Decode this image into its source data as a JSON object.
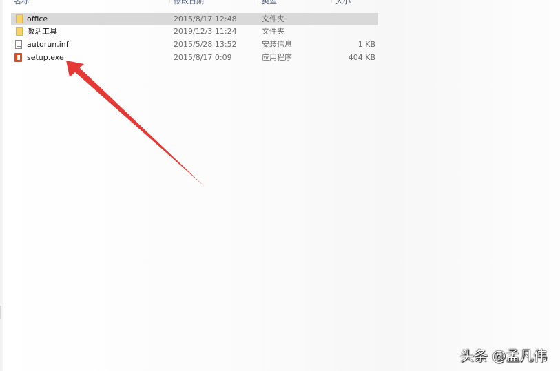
{
  "columns": {
    "name": "名称",
    "date": "修改日期",
    "type": "类型",
    "size": "大小"
  },
  "files": [
    {
      "name": "office",
      "date": "2015/8/17 12:48",
      "type": "文件夹",
      "size": "",
      "icon": "folder-icon",
      "selected": true
    },
    {
      "name": "激活工具",
      "date": "2019/12/3 11:24",
      "type": "文件夹",
      "size": "",
      "icon": "folder-icon",
      "selected": false
    },
    {
      "name": "autorun.inf",
      "date": "2015/5/28 13:52",
      "type": "安装信息",
      "size": "1 KB",
      "icon": "settings-file-icon",
      "selected": false
    },
    {
      "name": "setup.exe",
      "date": "2015/8/17 0:09",
      "type": "应用程序",
      "size": "404 KB",
      "icon": "office-icon",
      "selected": false
    }
  ],
  "annotation": {
    "arrow_color": "#e53935",
    "points_to": "setup.exe"
  },
  "watermark": "头条 @孟凡伟"
}
